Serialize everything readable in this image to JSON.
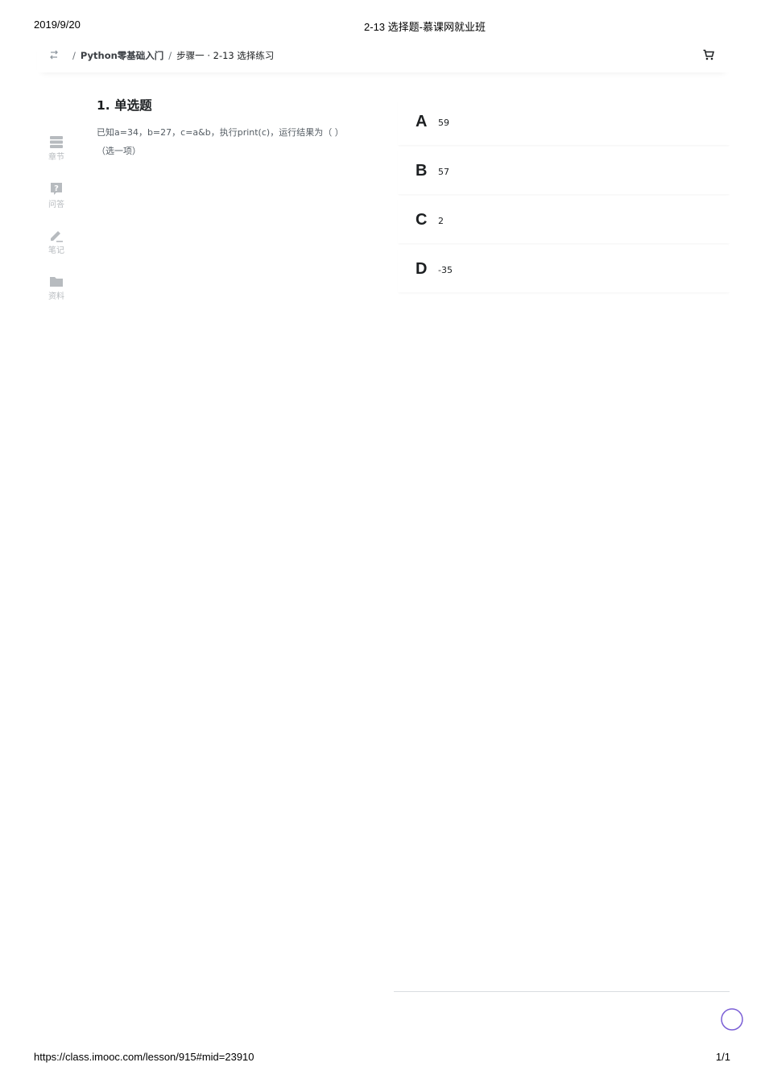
{
  "print_header": {
    "date": "2019/9/20",
    "title": "2-13 选择题-慕课网就业班"
  },
  "topbar": {
    "switch_icon": "swap-icon",
    "separator": "/",
    "course": "Python零基础入门",
    "current": "步骤一 · 2-13 选择练习",
    "cart_icon": "cart-icon"
  },
  "sidebar": {
    "items": [
      {
        "label": "章节",
        "icon": "chapter-icon"
      },
      {
        "label": "问答",
        "icon": "question-icon"
      },
      {
        "label": "笔记",
        "icon": "pencil-icon"
      },
      {
        "label": "资料",
        "icon": "folder-icon"
      }
    ]
  },
  "question": {
    "title": "1. 单选题",
    "text": "已知a=34，b=27，c=a&b，执行print(c)，运行结果为（ ）",
    "hint": "（选一项）"
  },
  "options": [
    {
      "letter": "A",
      "text": "59"
    },
    {
      "letter": "B",
      "text": "57"
    },
    {
      "letter": "C",
      "text": "2"
    },
    {
      "letter": "D",
      "text": "-35"
    }
  ],
  "print_footer": {
    "url": "https://class.imooc.com/lesson/915#mid=23910",
    "page": "1/1"
  },
  "colors": {
    "accent": "#7b5fd6",
    "icon_gray": "#b7bbbf",
    "text_secondary": "#545c63"
  }
}
